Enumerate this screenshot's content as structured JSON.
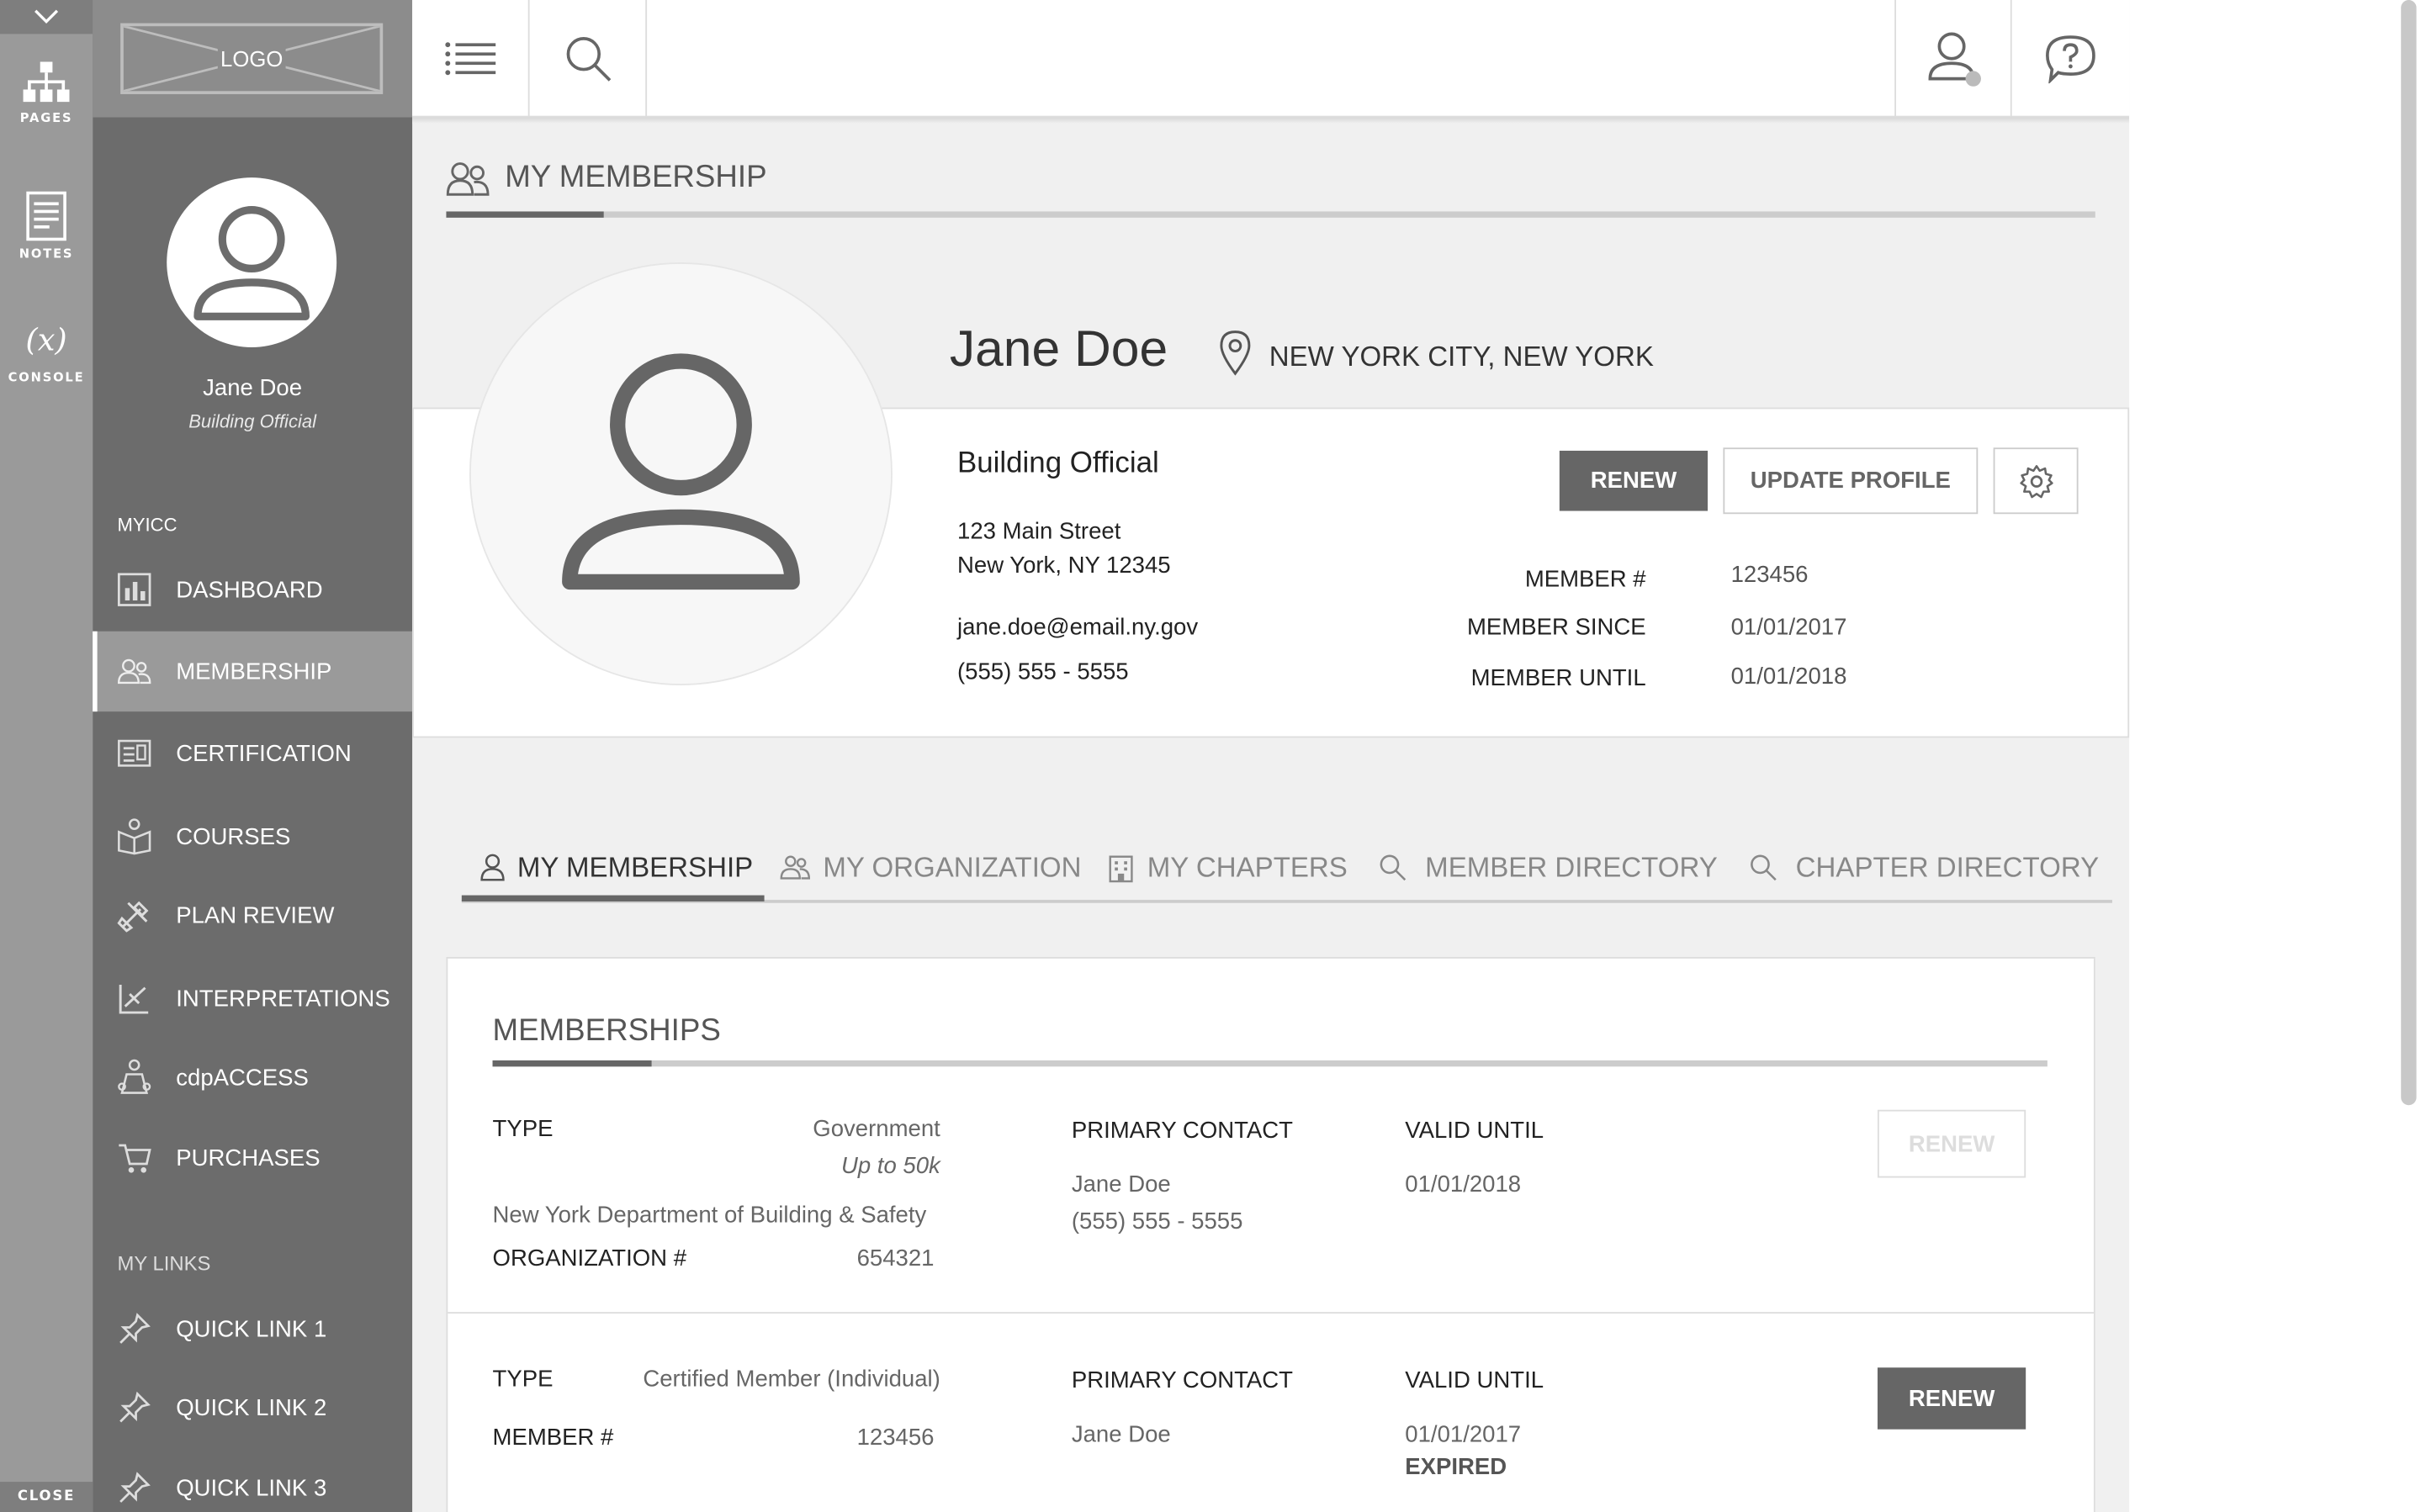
{
  "tool_strip": {
    "pages_label": "PAGES",
    "notes_label": "NOTES",
    "console_label": "CONSOLE",
    "console_glyph": "(x)",
    "close_label": "CLOSE"
  },
  "logo": {
    "text": "LOGO"
  },
  "user": {
    "name": "Jane Doe",
    "role": "Building Official"
  },
  "sidebar": {
    "section1": "MYICC",
    "items": [
      {
        "label": "DASHBOARD",
        "icon": "dashboard-icon"
      },
      {
        "label": "MEMBERSHIP",
        "icon": "membership-icon"
      },
      {
        "label": "CERTIFICATION",
        "icon": "certification-icon"
      },
      {
        "label": "COURSES",
        "icon": "courses-icon"
      },
      {
        "label": "PLAN REVIEW",
        "icon": "plan-review-icon"
      },
      {
        "label": "INTERPRETATIONS",
        "icon": "interpretations-icon"
      },
      {
        "label": "cdpACCESS",
        "icon": "cdpaccess-icon"
      },
      {
        "label": "PURCHASES",
        "icon": "cart-icon"
      }
    ],
    "section2": "MY LINKS",
    "links": [
      {
        "label": "QUICK LINK 1"
      },
      {
        "label": "QUICK LINK 2"
      },
      {
        "label": "QUICK LINK 3"
      }
    ]
  },
  "page": {
    "title": "MY MEMBERSHIP"
  },
  "profile": {
    "name": "Jane Doe",
    "location": "NEW YORK CITY, NEW YORK",
    "title": "Building Official",
    "address_line1": "123 Main Street",
    "address_line2": "New York, NY 12345",
    "email": "jane.doe@email.ny.gov",
    "phone": "(555) 555 - 5555",
    "renew_label": "RENEW",
    "update_label": "UPDATE PROFILE",
    "member_no_label": "MEMBER #",
    "member_no": "123456",
    "member_since_label": "MEMBER SINCE",
    "member_since": "01/01/2017",
    "member_until_label": "MEMBER UNTIL",
    "member_until": "01/01/2018"
  },
  "tabs": [
    {
      "label": "MY MEMBERSHIP"
    },
    {
      "label": "MY ORGANIZATION"
    },
    {
      "label": "MY CHAPTERS"
    },
    {
      "label": "MEMBER DIRECTORY"
    },
    {
      "label": "CHAPTER DIRECTORY"
    }
  ],
  "memberships": {
    "title": "MEMBERSHIPS",
    "rows": [
      {
        "type_label": "TYPE",
        "type": "Government",
        "type_sub": "Up to 50k",
        "org_name": "New York Department of Building & Safety",
        "id_label": "ORGANIZATION #",
        "id": "654321",
        "contact_label": "PRIMARY CONTACT",
        "contact_name": "Jane Doe",
        "contact_phone": "(555) 555 - 5555",
        "valid_label": "VALID UNTIL",
        "valid": "01/01/2018",
        "status": "",
        "renew_label": "RENEW"
      },
      {
        "type_label": "TYPE",
        "type": "Certified Member (Individual)",
        "id_label": "MEMBER #",
        "id": "123456",
        "contact_label": "PRIMARY CONTACT",
        "contact_name": "Jane Doe",
        "valid_label": "VALID UNTIL",
        "valid": "01/01/2017",
        "status": "EXPIRED",
        "renew_label": "RENEW"
      }
    ]
  }
}
